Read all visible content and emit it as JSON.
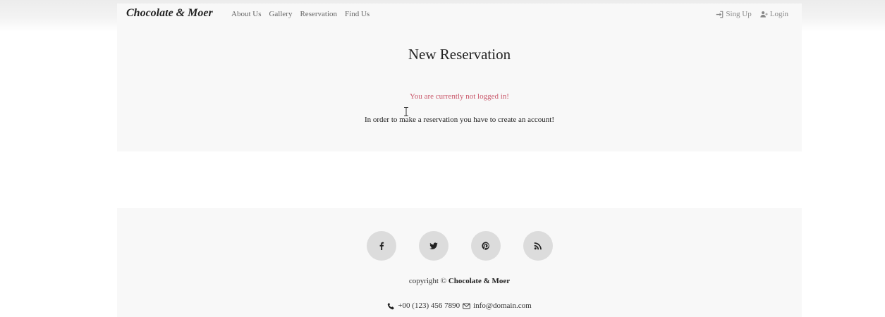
{
  "navbar": {
    "brand": "Chocolate & Moer",
    "links": [
      "About Us",
      "Gallery",
      "Reservation",
      "Find Us"
    ],
    "signup_label": "Sing Up",
    "login_label": "Login"
  },
  "main": {
    "title": "New Reservation",
    "warning": "You are currently not logged in!",
    "info": "In order to make a reservation you have to create an account!"
  },
  "footer": {
    "social": [
      {
        "icon": "facebook-icon"
      },
      {
        "icon": "twitter-icon"
      },
      {
        "icon": "pinterest-icon"
      },
      {
        "icon": "rss-icon"
      }
    ],
    "copyright_prefix": "copyright ©",
    "copyright_name": "Chocolate & Moer",
    "phone": "+00 (123) 456 7890",
    "email": "info@domain.com"
  },
  "colors": {
    "warning": "#c9576a",
    "panel": "#f8f8f8",
    "social_circle": "#dcdcdc"
  }
}
